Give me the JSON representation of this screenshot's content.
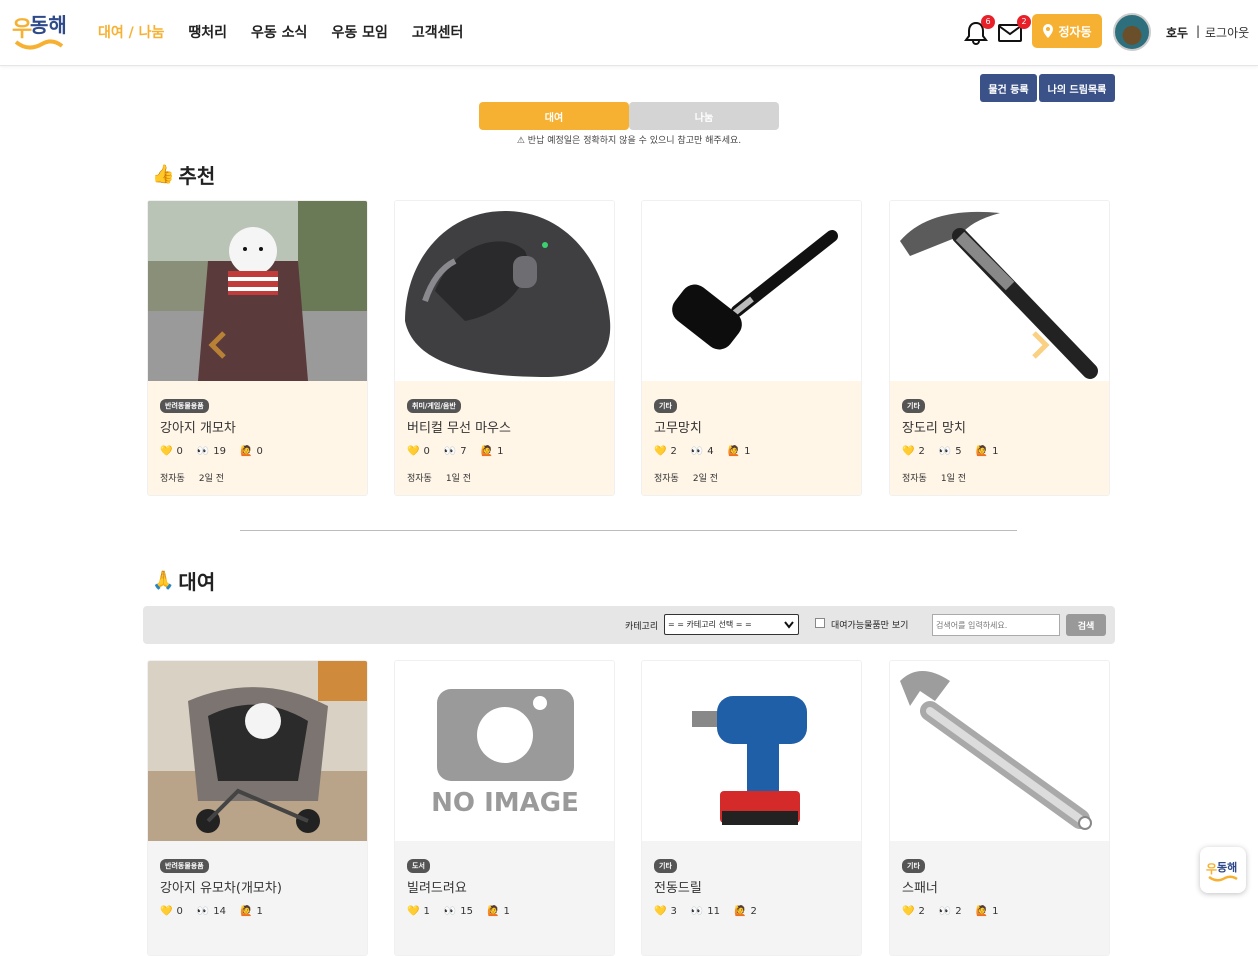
{
  "header": {
    "nav": [
      "대여 / 나눔",
      "땡처리",
      "우동 소식",
      "우동 모임",
      "고객센터"
    ],
    "bell_count": "6",
    "mail_count": "2",
    "location_label": "정자동",
    "user_name": "호두",
    "separator": "|",
    "logout_label": "로그아웃"
  },
  "actions": {
    "register_label": "물건 등록",
    "mydream_label": "나의 드림목록"
  },
  "toggle": {
    "rent_label": "대여",
    "share_label": "나눔"
  },
  "notice": "⚠ 반납 예정일은 정확하지 않을 수 있으니 참고만 해주세요.",
  "recommend": {
    "title": "추천",
    "cards": [
      {
        "category": "반려동물용품",
        "title": "강아지 개모차",
        "likes": "0",
        "views": "19",
        "hands": "0",
        "location": "정자동",
        "time": "2일 전"
      },
      {
        "category": "취미/게임/음반",
        "title": "버티컬 무선 마우스",
        "likes": "0",
        "views": "7",
        "hands": "1",
        "location": "정자동",
        "time": "1일 전"
      },
      {
        "category": "기타",
        "title": "고무망치",
        "likes": "2",
        "views": "4",
        "hands": "1",
        "location": "정자동",
        "time": "2일 전"
      },
      {
        "category": "기타",
        "title": "장도리 망치",
        "likes": "2",
        "views": "5",
        "hands": "1",
        "location": "정자동",
        "time": "1일 전"
      }
    ]
  },
  "rent": {
    "title": "대여",
    "category_label": "카테고리",
    "category_select": "= = 카테고리 선택 = =",
    "available_label": "대여가능물품만 보기",
    "search_placeholder": "검색어를 입력하세요.",
    "search_button": "검색",
    "cards": [
      {
        "category": "반려동물용품",
        "title": "강아지 유모차(개모차)",
        "likes": "0",
        "views": "14",
        "hands": "1"
      },
      {
        "category": "도서",
        "title": "빌려드려요",
        "likes": "1",
        "views": "15",
        "hands": "1"
      },
      {
        "category": "기타",
        "title": "전동드릴",
        "likes": "3",
        "views": "11",
        "hands": "2"
      },
      {
        "category": "기타",
        "title": "스패너",
        "likes": "2",
        "views": "2",
        "hands": "1"
      }
    ],
    "no_image_text": "NO IMAGE"
  },
  "logo_text": "우동해",
  "colors": {
    "accent": "#f7b132",
    "navy": "#3b5289",
    "badge": "#e8202a"
  }
}
